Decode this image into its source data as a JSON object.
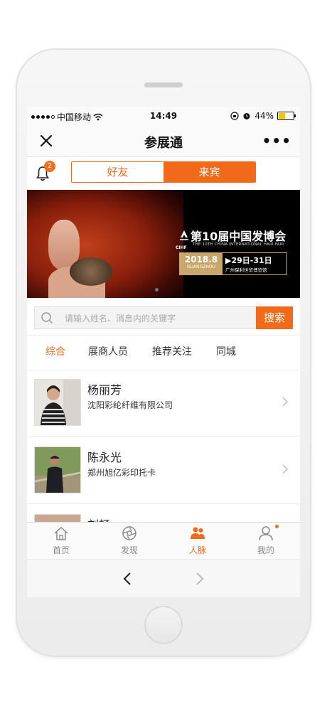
{
  "status_bar": {
    "carrier": "中国移动",
    "time": "14:49",
    "battery": "44%",
    "battery_level": 0.44
  },
  "nav": {
    "title": "参展通"
  },
  "notifications": {
    "count": "2"
  },
  "segment": {
    "friends": "好友",
    "guests": "来宾",
    "selected": "来宾"
  },
  "banner": {
    "logo_text": "CIHF",
    "title": "第10届中国发博会",
    "subtitle": "THE 10TH CHINA INTERNATIONAL HAIR FAIR",
    "date_year": "2018.8",
    "city_en": "GUANGZHOU",
    "date_range": "▶29日-31日",
    "venue": "广州保利世贸博览馆"
  },
  "search": {
    "placeholder": "请输入姓名、消息内的关键字",
    "value": "",
    "button": "搜索"
  },
  "filters": {
    "items": [
      "综合",
      "展商人员",
      "推荐关注",
      "同城"
    ],
    "active": "综合"
  },
  "people": [
    {
      "name": "杨丽芳",
      "company": "沈阳彩纶纤维有限公司"
    },
    {
      "name": "陈永光",
      "company": "郑州旭亿彩印托卡"
    },
    {
      "name": "刘畅",
      "company": ""
    }
  ],
  "tabs": [
    {
      "label": "首页",
      "icon": "home-icon"
    },
    {
      "label": "发现",
      "icon": "discover-icon"
    },
    {
      "label": "人脉",
      "icon": "contacts-icon"
    },
    {
      "label": "我的",
      "icon": "profile-icon"
    }
  ],
  "active_tab": "人脉",
  "colors": {
    "accent": "#f06a1a",
    "text": "#222222",
    "muted": "#888888"
  }
}
